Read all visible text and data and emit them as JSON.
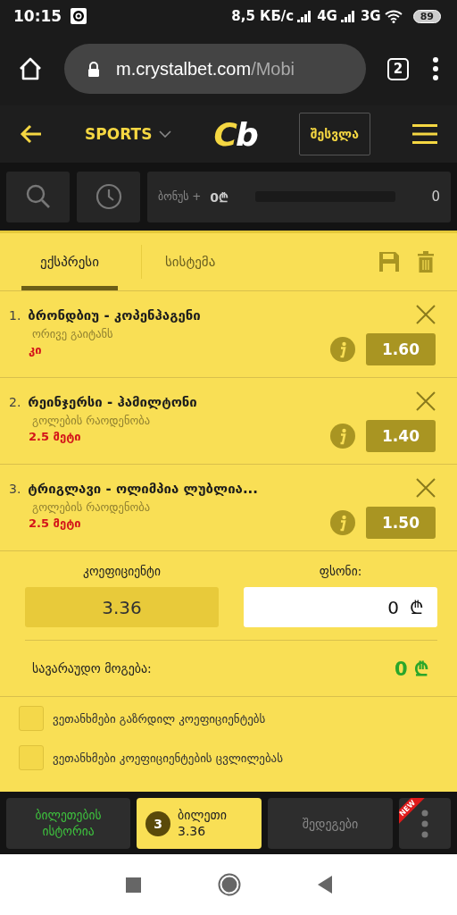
{
  "status_bar": {
    "time": "10:15",
    "speed": "8,5 КБ/с",
    "network_1": "4G",
    "network_2": "3G",
    "battery": "89"
  },
  "browser": {
    "url_host": "m.crystalbet.com",
    "url_path": "/Mobi",
    "tab_count": "2"
  },
  "header": {
    "sports": "SPORTS",
    "logo_first": "C",
    "logo_rest": "b",
    "login": "შესვლა"
  },
  "toolbar": {
    "bonus_label": "ბონუს +",
    "bonus_value": "0₾",
    "progress": "0"
  },
  "tabs": [
    {
      "label": "ექსპრესი",
      "selected": true
    },
    {
      "label": "სისტემა",
      "selected": false
    }
  ],
  "bets": [
    {
      "number": "1.",
      "match": "ბრონდბიუ - კოპენჰაგენი",
      "market": "ორივე გაიტანს",
      "pick": "კი",
      "odds": "1.60"
    },
    {
      "number": "2.",
      "match": "რეინჯერსი - ჰამილტონი",
      "market": "გოლების რაოდენობა",
      "pick": "2.5 მეტი",
      "odds": "1.40"
    },
    {
      "number": "3.",
      "match": "ტრიგლავი - ოლიმპია ლუბლია...",
      "market": "გოლების რაოდენობა",
      "pick": "2.5 მეტი",
      "odds": "1.50"
    }
  ],
  "totals": {
    "odds_label": "კოეფიციენტი",
    "odds_value": "3.36",
    "stake_label": "ფსონი:",
    "stake_value": "0",
    "stake_currency": "₾",
    "win_label": "სავარაუდო მოგება:",
    "win_value": "0",
    "win_currency": "₾"
  },
  "options": [
    {
      "label": "ვეთანხმები გაზრდილ კოეფიციენტებს",
      "checked": false
    },
    {
      "label": "ვეთანხმები კოეფიციენტების ცვლილებას",
      "checked": false
    }
  ],
  "bottom_nav": [
    {
      "kind": "history",
      "label": "ბილეთების ისტორია"
    },
    {
      "kind": "ticket",
      "count": "3",
      "label": "ბილეთი",
      "value": "3.36"
    },
    {
      "kind": "results",
      "label": "შედეგები"
    },
    {
      "kind": "more",
      "ribbon": "NEW"
    }
  ]
}
